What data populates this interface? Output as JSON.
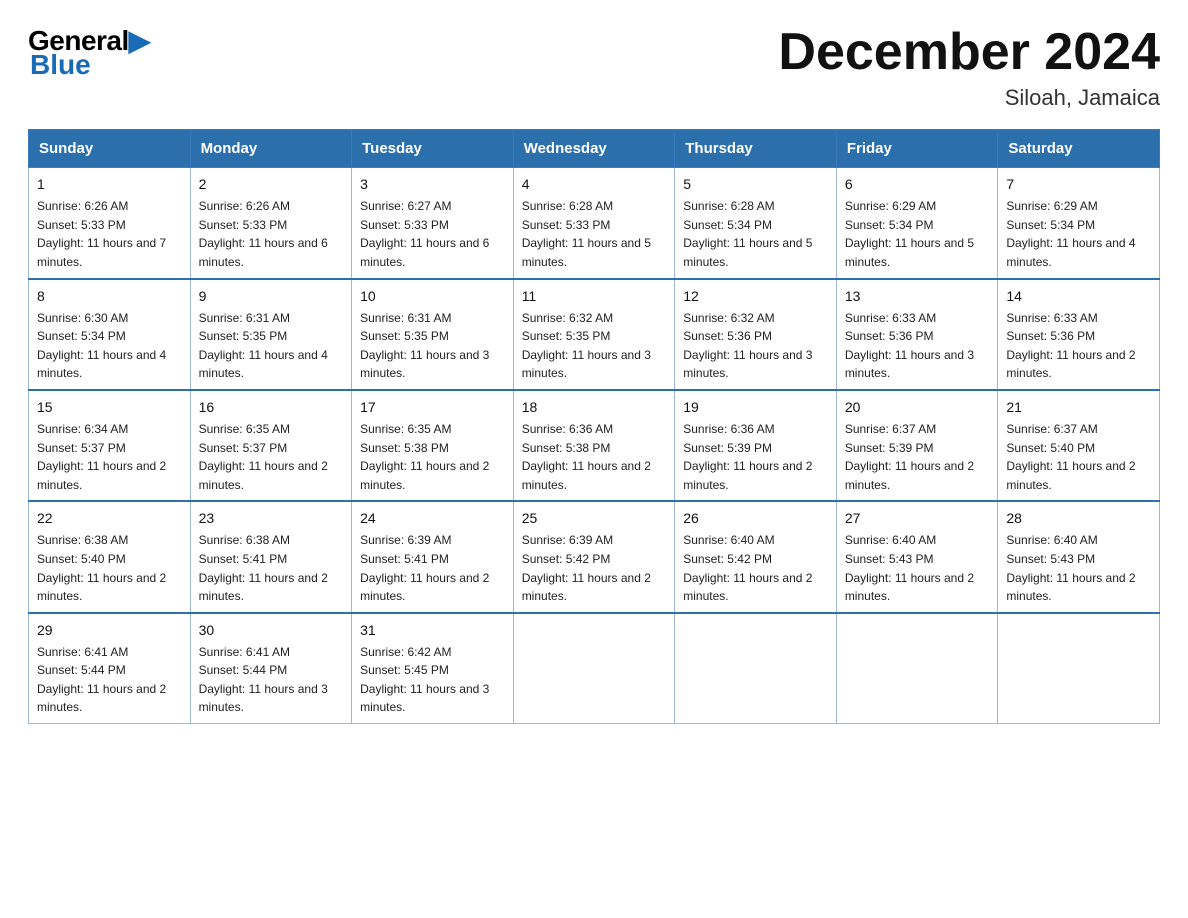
{
  "header": {
    "logo_general": "General",
    "logo_blue": "Blue",
    "title": "December 2024",
    "subtitle": "Siloah, Jamaica"
  },
  "days_of_week": [
    "Sunday",
    "Monday",
    "Tuesday",
    "Wednesday",
    "Thursday",
    "Friday",
    "Saturday"
  ],
  "weeks": [
    [
      {
        "day": "1",
        "sunrise": "6:26 AM",
        "sunset": "5:33 PM",
        "daylight": "11 hours and 7 minutes."
      },
      {
        "day": "2",
        "sunrise": "6:26 AM",
        "sunset": "5:33 PM",
        "daylight": "11 hours and 6 minutes."
      },
      {
        "day": "3",
        "sunrise": "6:27 AM",
        "sunset": "5:33 PM",
        "daylight": "11 hours and 6 minutes."
      },
      {
        "day": "4",
        "sunrise": "6:28 AM",
        "sunset": "5:33 PM",
        "daylight": "11 hours and 5 minutes."
      },
      {
        "day": "5",
        "sunrise": "6:28 AM",
        "sunset": "5:34 PM",
        "daylight": "11 hours and 5 minutes."
      },
      {
        "day": "6",
        "sunrise": "6:29 AM",
        "sunset": "5:34 PM",
        "daylight": "11 hours and 5 minutes."
      },
      {
        "day": "7",
        "sunrise": "6:29 AM",
        "sunset": "5:34 PM",
        "daylight": "11 hours and 4 minutes."
      }
    ],
    [
      {
        "day": "8",
        "sunrise": "6:30 AM",
        "sunset": "5:34 PM",
        "daylight": "11 hours and 4 minutes."
      },
      {
        "day": "9",
        "sunrise": "6:31 AM",
        "sunset": "5:35 PM",
        "daylight": "11 hours and 4 minutes."
      },
      {
        "day": "10",
        "sunrise": "6:31 AM",
        "sunset": "5:35 PM",
        "daylight": "11 hours and 3 minutes."
      },
      {
        "day": "11",
        "sunrise": "6:32 AM",
        "sunset": "5:35 PM",
        "daylight": "11 hours and 3 minutes."
      },
      {
        "day": "12",
        "sunrise": "6:32 AM",
        "sunset": "5:36 PM",
        "daylight": "11 hours and 3 minutes."
      },
      {
        "day": "13",
        "sunrise": "6:33 AM",
        "sunset": "5:36 PM",
        "daylight": "11 hours and 3 minutes."
      },
      {
        "day": "14",
        "sunrise": "6:33 AM",
        "sunset": "5:36 PM",
        "daylight": "11 hours and 2 minutes."
      }
    ],
    [
      {
        "day": "15",
        "sunrise": "6:34 AM",
        "sunset": "5:37 PM",
        "daylight": "11 hours and 2 minutes."
      },
      {
        "day": "16",
        "sunrise": "6:35 AM",
        "sunset": "5:37 PM",
        "daylight": "11 hours and 2 minutes."
      },
      {
        "day": "17",
        "sunrise": "6:35 AM",
        "sunset": "5:38 PM",
        "daylight": "11 hours and 2 minutes."
      },
      {
        "day": "18",
        "sunrise": "6:36 AM",
        "sunset": "5:38 PM",
        "daylight": "11 hours and 2 minutes."
      },
      {
        "day": "19",
        "sunrise": "6:36 AM",
        "sunset": "5:39 PM",
        "daylight": "11 hours and 2 minutes."
      },
      {
        "day": "20",
        "sunrise": "6:37 AM",
        "sunset": "5:39 PM",
        "daylight": "11 hours and 2 minutes."
      },
      {
        "day": "21",
        "sunrise": "6:37 AM",
        "sunset": "5:40 PM",
        "daylight": "11 hours and 2 minutes."
      }
    ],
    [
      {
        "day": "22",
        "sunrise": "6:38 AM",
        "sunset": "5:40 PM",
        "daylight": "11 hours and 2 minutes."
      },
      {
        "day": "23",
        "sunrise": "6:38 AM",
        "sunset": "5:41 PM",
        "daylight": "11 hours and 2 minutes."
      },
      {
        "day": "24",
        "sunrise": "6:39 AM",
        "sunset": "5:41 PM",
        "daylight": "11 hours and 2 minutes."
      },
      {
        "day": "25",
        "sunrise": "6:39 AM",
        "sunset": "5:42 PM",
        "daylight": "11 hours and 2 minutes."
      },
      {
        "day": "26",
        "sunrise": "6:40 AM",
        "sunset": "5:42 PM",
        "daylight": "11 hours and 2 minutes."
      },
      {
        "day": "27",
        "sunrise": "6:40 AM",
        "sunset": "5:43 PM",
        "daylight": "11 hours and 2 minutes."
      },
      {
        "day": "28",
        "sunrise": "6:40 AM",
        "sunset": "5:43 PM",
        "daylight": "11 hours and 2 minutes."
      }
    ],
    [
      {
        "day": "29",
        "sunrise": "6:41 AM",
        "sunset": "5:44 PM",
        "daylight": "11 hours and 2 minutes."
      },
      {
        "day": "30",
        "sunrise": "6:41 AM",
        "sunset": "5:44 PM",
        "daylight": "11 hours and 3 minutes."
      },
      {
        "day": "31",
        "sunrise": "6:42 AM",
        "sunset": "5:45 PM",
        "daylight": "11 hours and 3 minutes."
      },
      null,
      null,
      null,
      null
    ]
  ]
}
